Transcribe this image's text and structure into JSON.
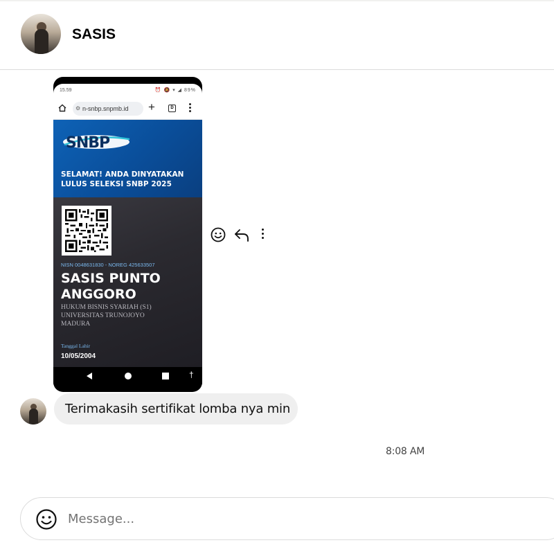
{
  "header": {
    "contact_name": "SASIS"
  },
  "shared_image": {
    "status_time": "15.59",
    "status_icons": "⏰ 🔕 ▾ ◢ 89%",
    "url": "n-snbp.snpmb.id",
    "url_tune_icon": "tune-icon",
    "tabs_count": "D",
    "logo_text": "SNBP",
    "banner_title_line1": "SELAMAT! ANDA DINYATAKAN",
    "banner_title_line2": "LULUS SELEKSI SNBP 2025",
    "nisn_line": "NISN 0048631830 - NOREG 425633507",
    "student_name_line1": "SASIS PUNTO",
    "student_name_line2": "ANGGORO",
    "program_line1": "HUKUM BISNIS SYARIAH (S1)",
    "program_line2": "UNIVERSITAS TRUNOJOYO",
    "program_line3": "MADURA",
    "dob_label": "Tanggal Lahir",
    "dob_value": "10/05/2004",
    "accessibility_icon": "†"
  },
  "message_actions": {
    "react_icon": "smiley-icon",
    "reply_icon": "reply-icon",
    "more_icon": "more-options-icon"
  },
  "messages": [
    {
      "sender": "SASIS",
      "text": "Terimakasih sertifikat lomba nya min"
    }
  ],
  "timestamp": "8:08 AM",
  "composer": {
    "placeholder": "Message...",
    "value": ""
  },
  "colors": {
    "bubble": "#efefef",
    "banner_blue": "#0e62b6",
    "card_dark": "#2b2a30",
    "accent_text": "#7ab8ee"
  }
}
